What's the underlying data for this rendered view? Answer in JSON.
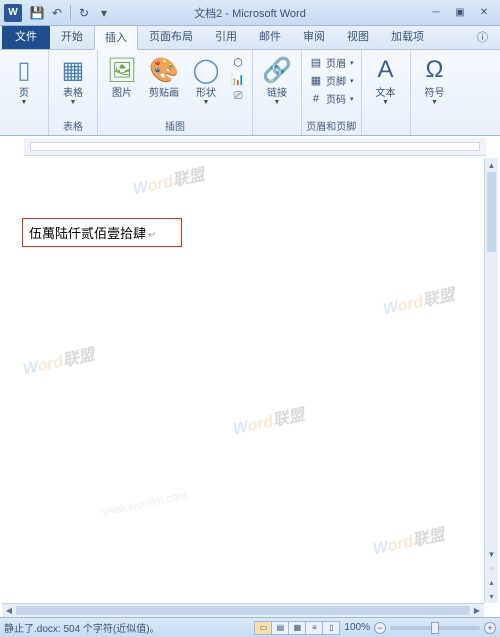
{
  "app_logo": "W",
  "title": "文档2 - Microsoft Word",
  "qat": {
    "save": "💾",
    "undo": "↶",
    "redo": "↻"
  },
  "tabs": {
    "file": "文件",
    "home": "开始",
    "insert": "插入",
    "layout": "页面布局",
    "references": "引用",
    "mailings": "邮件",
    "review": "审阅",
    "view": "视图",
    "addins": "加载项"
  },
  "ribbon": {
    "pages": {
      "page": "页",
      "label": ""
    },
    "tables": {
      "table": "表格",
      "label": "表格"
    },
    "illustrations": {
      "picture": "图片",
      "clipart": "剪贴画",
      "shapes": "形状",
      "smartart": "",
      "chart": "",
      "label": "插图"
    },
    "links": {
      "hyperlink": "链接",
      "label": ""
    },
    "header_footer": {
      "header": "页眉",
      "footer": "页脚",
      "pagenum": "页码",
      "label": "页眉和页脚"
    },
    "text": {
      "textbox": "文本",
      "label": ""
    },
    "symbols": {
      "symbol": "符号",
      "label": ""
    }
  },
  "document": {
    "text": "伍萬陆仟贰佰壹拾肆"
  },
  "watermark": {
    "brand_w": "W",
    "brand_ord": "ord",
    "brand_cn": "联盟",
    "url": "www.wordlm.com"
  },
  "status": {
    "left": "静止了.docx: 504 个字符(近似值)。",
    "zoom": "100%"
  }
}
